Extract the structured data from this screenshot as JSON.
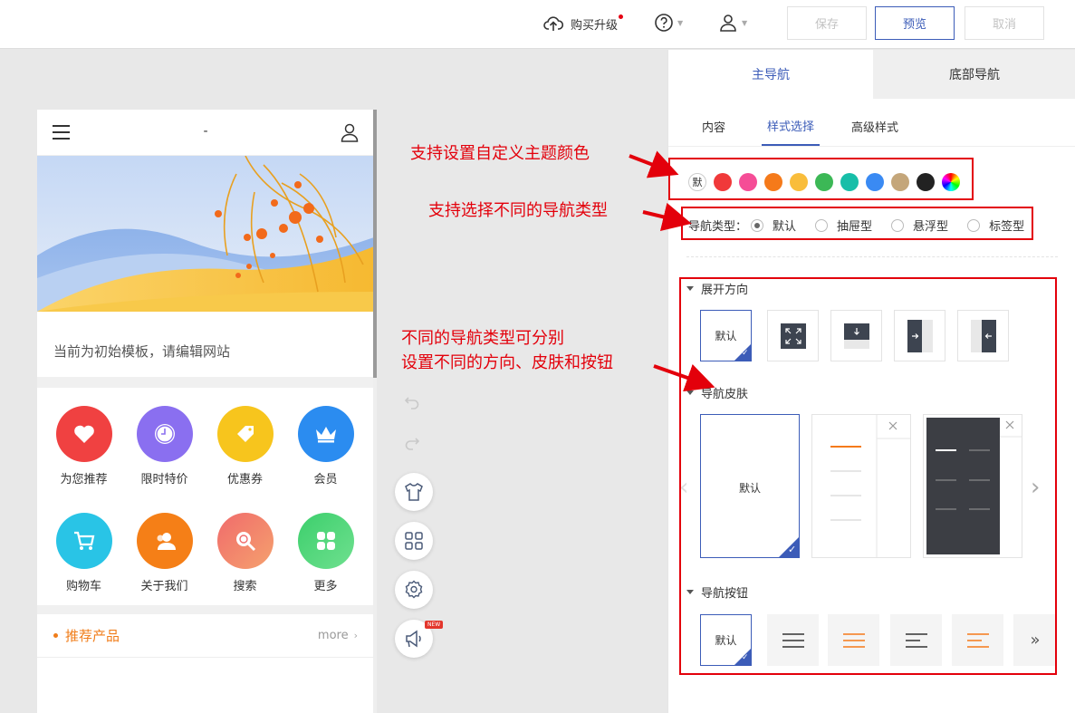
{
  "topbar": {
    "upgrade_label": "购买升级",
    "save_label": "保存",
    "preview_label": "预览",
    "cancel_label": "取消"
  },
  "phone": {
    "header_title": "-",
    "notice": "当前为初始模板，请编辑网站",
    "grid_items": [
      {
        "label": "为您推荐",
        "color": "#f04141",
        "icon": "heart-icon"
      },
      {
        "label": "限时特价",
        "color": "#8a6ff0",
        "icon": "clock-icon"
      },
      {
        "label": "优惠券",
        "color": "#f7c51d",
        "icon": "tag-icon"
      },
      {
        "label": "会员",
        "color": "#2b8cf0",
        "icon": "crown-icon"
      },
      {
        "label": "购物车",
        "color": "#29c4e6",
        "icon": "cart-icon"
      },
      {
        "label": "关于我们",
        "color": "#f57f17",
        "icon": "people-icon"
      },
      {
        "label": "搜索",
        "color": "#f08080",
        "icon": "search-icon"
      },
      {
        "label": "更多",
        "color": "#4cd37a",
        "icon": "grid-icon"
      }
    ],
    "recommend_title": "推荐产品",
    "recommend_more": "more"
  },
  "panel": {
    "tab_main": "主导航",
    "tab_bottom": "底部导航",
    "subtabs": [
      "内容",
      "样式选择",
      "高级样式"
    ],
    "color_default": "默",
    "colors": [
      "#f0393a",
      "#f54d96",
      "#f57a1a",
      "#f9bd3b",
      "#3cb856",
      "#17bea8",
      "#3a8af3",
      "#c4a67a",
      "#222222"
    ],
    "navtype_label": "导航类型：",
    "navtypes": [
      "默认",
      "抽屉型",
      "悬浮型",
      "标签型"
    ],
    "sec_expand": "展开方向",
    "sec_skin": "导航皮肤",
    "sec_button": "导航按钮",
    "default_label": "默认",
    "more_label": "»"
  },
  "annotations": {
    "a1": "支持设置自定义主题颜色",
    "a2": "支持选择不同的导航类型",
    "a3_line1": "不同的导航类型可分别",
    "a3_line2": "设置不同的方向、皮肤和按钮"
  },
  "accent": "#3c5cb8",
  "annotation_color": "#e3000b"
}
